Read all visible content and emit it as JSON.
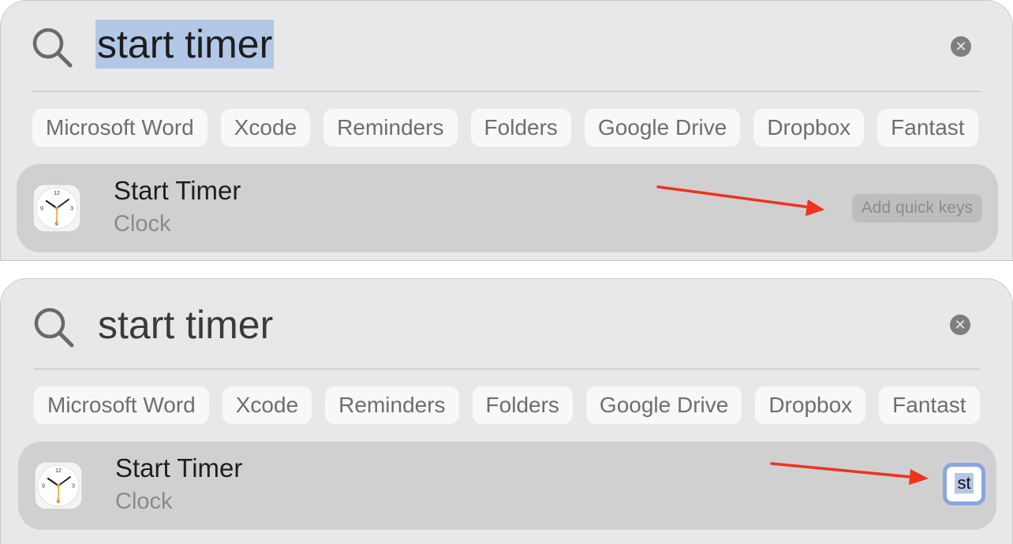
{
  "top": {
    "query": "start timer",
    "chips": [
      "Microsoft Word",
      "Xcode",
      "Reminders",
      "Folders",
      "Google Drive",
      "Dropbox",
      "Fantast"
    ],
    "result": {
      "title": "Start Timer",
      "subtitle": "Clock",
      "action_label": "Add quick keys"
    }
  },
  "bottom": {
    "query": "start timer",
    "chips": [
      "Microsoft Word",
      "Xcode",
      "Reminders",
      "Folders",
      "Google Drive",
      "Dropbox",
      "Fantast"
    ],
    "result": {
      "title": "Start Timer",
      "subtitle": "Clock",
      "quick_key_value": "st"
    }
  },
  "clock_face": {
    "numerals": [
      "12",
      "3",
      "6",
      "9"
    ]
  },
  "icons": {
    "search": "magnifying-glass",
    "clear": "x-circle",
    "app": "clock-app"
  },
  "colors": {
    "annotation_arrow": "#f0321e",
    "selection_highlight": "#b3c7e6",
    "focus_ring": "#8ba4df",
    "panel_background": "#e8e8e8",
    "result_row": "#d0d0d0"
  }
}
